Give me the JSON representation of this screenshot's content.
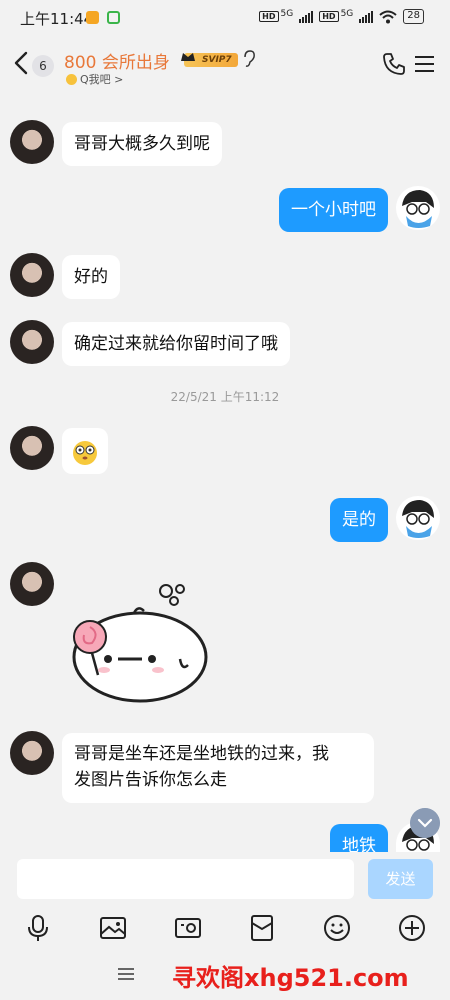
{
  "status_bar": {
    "time": "上午11:44",
    "network1": "HD",
    "network_type1": "5G",
    "network2": "HD",
    "network_type2": "5G",
    "battery": "28"
  },
  "header": {
    "back_badge": "6",
    "title": "800 会所出身",
    "vip_label": "SVIP7",
    "subtitle": "Q我吧 >"
  },
  "messages": [
    {
      "side": "in",
      "text": "哥哥大概多久到呢"
    },
    {
      "side": "out",
      "text": "一个小时吧"
    },
    {
      "side": "in",
      "text": "好的"
    },
    {
      "side": "in",
      "text": "确定过来就给你留时间了哦"
    },
    {
      "type": "timestamp",
      "text": "22/5/21 上午11:12"
    },
    {
      "side": "in",
      "type": "emoji"
    },
    {
      "side": "out",
      "text": "是的"
    },
    {
      "side": "in",
      "type": "sticker"
    },
    {
      "side": "in",
      "text_line1": "哥哥是坐车还是坐地铁的过来，我",
      "text_line2": "发图片告诉你怎么走"
    },
    {
      "side": "out",
      "text": "地铁"
    }
  ],
  "input": {
    "value": "",
    "placeholder": "",
    "send_label": "发送"
  },
  "toolbar_icons": [
    "microphone-icon",
    "image-icon",
    "camera-icon",
    "red-packet-icon",
    "emoji-icon",
    "plus-icon"
  ],
  "watermark": "寻欢阁xhg521.com",
  "colors": {
    "title": "#e8783a",
    "out_bubble": "#1e9bff",
    "send_button": "#aad6ff",
    "watermark": "#e8201c"
  }
}
